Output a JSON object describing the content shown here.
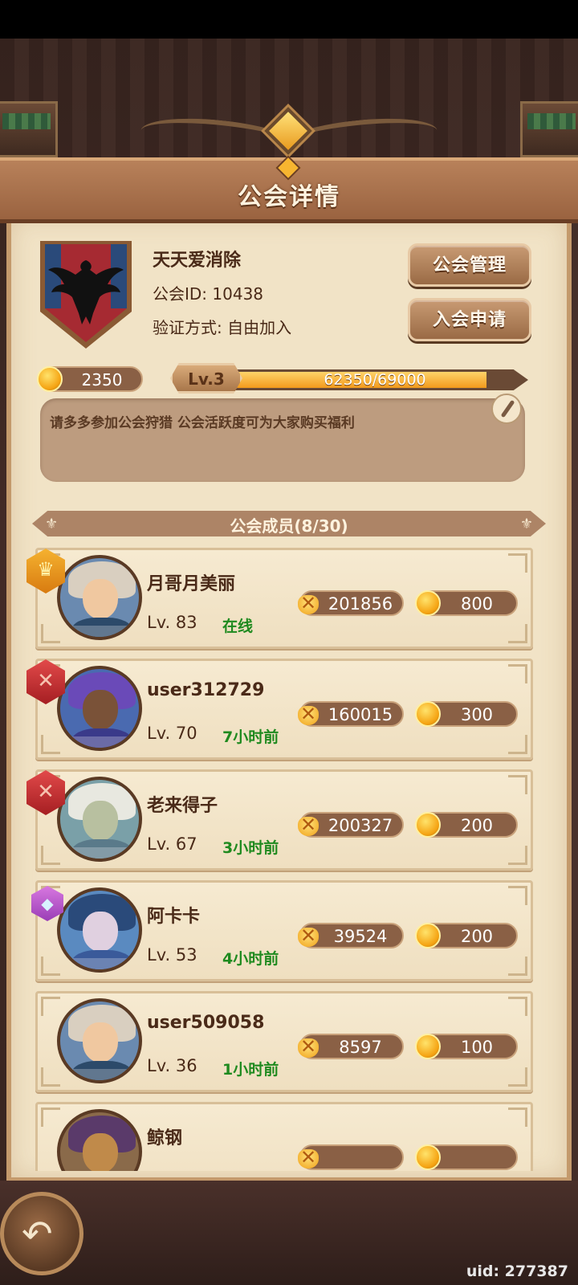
{
  "header": {
    "title": "公会详情"
  },
  "guild": {
    "name": "天天爱消除",
    "id_text": "公会ID: 10438",
    "verify_text": "验证方式: 自由加入",
    "coins": "2350",
    "level": "Lv.3",
    "xp_text": "62350/69000",
    "xp_fraction": 0.9036,
    "notice": "请多多参加公会狩猎 公会活跃度可为大家购买福利"
  },
  "buttons": {
    "manage": "公会管理",
    "apply": "入会申请"
  },
  "members_header": "公会成员(8/30)",
  "members": [
    {
      "name": "月哥月美丽",
      "level": "Lv. 83",
      "status": "在线",
      "contribution": "201856",
      "gold": "800",
      "badge": "crown",
      "skin": "#f0c8a0",
      "hair": "#d9cfc0",
      "cloth": "#2c4a6a",
      "bg": "#6a8ab0"
    },
    {
      "name": "user312729",
      "level": "Lv. 70",
      "status": "7小时前",
      "contribution": "160015",
      "gold": "300",
      "badge": "sword",
      "skin": "#7a5238",
      "hair": "#6a4ab8",
      "cloth": "#3a3a8a",
      "bg": "#4a6ab0"
    },
    {
      "name": "老来得子",
      "level": "Lv. 67",
      "status": "3小时前",
      "contribution": "200327",
      "gold": "200",
      "badge": "sword",
      "skin": "#b8c0a0",
      "hair": "#e8e8e0",
      "cloth": "#5a7a8a",
      "bg": "#7aa0a8"
    },
    {
      "name": "阿卡卡",
      "level": "Lv. 53",
      "status": "4小时前",
      "contribution": "39524",
      "gold": "200",
      "badge": "gem",
      "skin": "#e0d0e0",
      "hair": "#2a4a7a",
      "cloth": "#3a5a9a",
      "bg": "#5a8ac0"
    },
    {
      "name": "user509058",
      "level": "Lv. 36",
      "status": "1小时前",
      "contribution": "8597",
      "gold": "100",
      "badge": "none",
      "skin": "#f0c8a0",
      "hair": "#d9cfc0",
      "cloth": "#2c4a6a",
      "bg": "#6a8ab0"
    },
    {
      "name": "鲸钢",
      "level": "",
      "status": "",
      "contribution": "",
      "gold": "",
      "badge": "none",
      "skin": "#c08a4a",
      "hair": "#5a3a6a",
      "cloth": "#6a4a2a",
      "bg": "#8a6a4a"
    }
  ],
  "footer": {
    "uid": "uid: 277387"
  },
  "icons": {
    "back": "back-arrow-icon",
    "edit": "feather-edit-icon",
    "coin": "gold-coin-icon",
    "contribution": "crossed-swords-icon"
  }
}
